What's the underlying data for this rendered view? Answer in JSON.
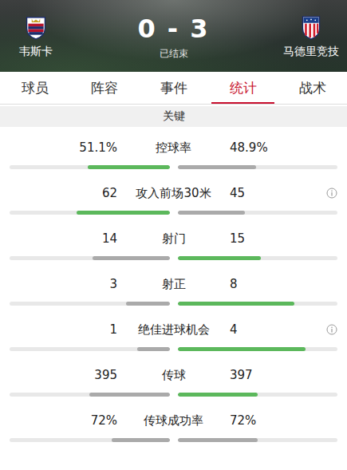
{
  "header": {
    "home": {
      "name": "韦斯卡"
    },
    "away": {
      "name": "马德里竞技"
    },
    "score": "0 - 3",
    "status": "已结束"
  },
  "tabs": [
    {
      "label": "球员",
      "selected": false
    },
    {
      "label": "阵容",
      "selected": false
    },
    {
      "label": "事件",
      "selected": false
    },
    {
      "label": "统计",
      "selected": true
    },
    {
      "label": "战术",
      "selected": false
    }
  ],
  "section": {
    "title": "关键"
  },
  "stats": [
    {
      "label": "控球率",
      "info": false,
      "home": {
        "value": "51.1%",
        "level": 0.511,
        "color": "#5cb85c"
      },
      "away": {
        "value": "48.9%",
        "level": 0.489,
        "color": "#aaaaaa"
      }
    },
    {
      "label": "攻入前场30米",
      "info": true,
      "home": {
        "value": "62",
        "level": 0.58,
        "color": "#5cb85c"
      },
      "away": {
        "value": "45",
        "level": 0.42,
        "color": "#aaaaaa"
      }
    },
    {
      "label": "射门",
      "info": false,
      "home": {
        "value": "14",
        "level": 0.48,
        "color": "#aaaaaa"
      },
      "away": {
        "value": "15",
        "level": 0.52,
        "color": "#5cb85c"
      }
    },
    {
      "label": "射正",
      "info": false,
      "home": {
        "value": "3",
        "level": 0.27,
        "color": "#aaaaaa"
      },
      "away": {
        "value": "8",
        "level": 0.73,
        "color": "#5cb85c"
      }
    },
    {
      "label": "绝佳进球机会",
      "info": true,
      "home": {
        "value": "1",
        "level": 0.2,
        "color": "#aaaaaa"
      },
      "away": {
        "value": "4",
        "level": 0.8,
        "color": "#5cb85c"
      }
    },
    {
      "label": "传球",
      "info": false,
      "home": {
        "value": "395",
        "level": 0.5,
        "color": "#aaaaaa"
      },
      "away": {
        "value": "397",
        "level": 0.5,
        "color": "#5cb85c"
      }
    },
    {
      "label": "传球成功率",
      "info": false,
      "home": {
        "value": "72%",
        "level": 0.36,
        "color": "#aaaaaa"
      },
      "away": {
        "value": "72%",
        "level": 0.5,
        "color": "#aaaaaa"
      }
    }
  ]
}
